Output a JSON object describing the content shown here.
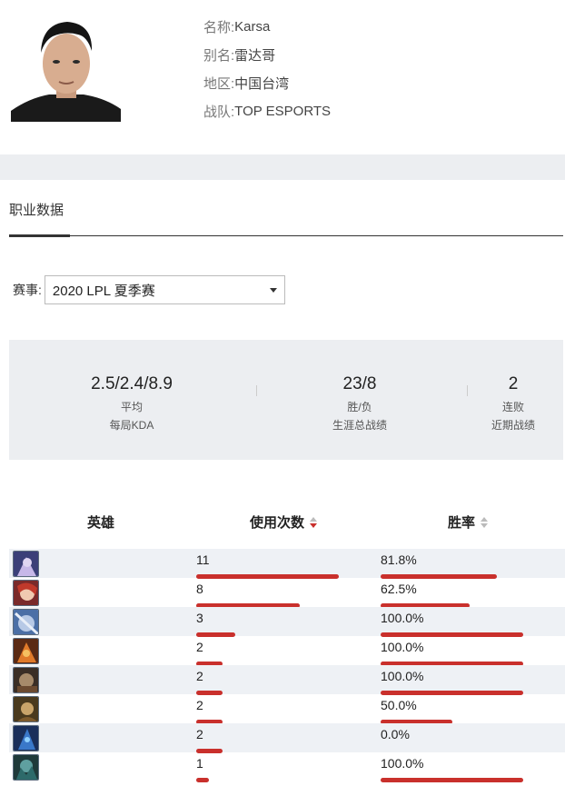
{
  "profile": {
    "name_label": "名称:",
    "name_value": "Karsa",
    "alias_label": "别名:",
    "alias_value": "雷达哥",
    "region_label": "地区:",
    "region_value": "中国台湾",
    "team_label": "战队:",
    "team_value": "TOP ESPORTS"
  },
  "tabs": {
    "active": "职业数据"
  },
  "filter": {
    "label": "赛事:",
    "selected": "2020 LPL 夏季赛"
  },
  "stats": [
    {
      "main": "2.5/2.4/8.9",
      "sub1": "平均",
      "sub2": "每局KDA"
    },
    {
      "main": "23/8",
      "sub1": "胜/负",
      "sub2": "生涯总战绩"
    },
    {
      "main": "2",
      "sub1": "连败",
      "sub2": "近期战绩"
    }
  ],
  "table": {
    "col_hero": "英雄",
    "col_count": "使用次数",
    "col_winrate": "胜率",
    "rows": [
      {
        "hero_icon": "champion-icon-1",
        "count": "11",
        "count_fraction": 1.0,
        "winrate": "81.8%",
        "winrate_fraction": 0.818
      },
      {
        "hero_icon": "champion-icon-2",
        "count": "8",
        "count_fraction": 0.727,
        "winrate": "62.5%",
        "winrate_fraction": 0.625
      },
      {
        "hero_icon": "champion-icon-3",
        "count": "3",
        "count_fraction": 0.273,
        "winrate": "100.0%",
        "winrate_fraction": 1.0
      },
      {
        "hero_icon": "champion-icon-4",
        "count": "2",
        "count_fraction": 0.182,
        "winrate": "100.0%",
        "winrate_fraction": 1.0
      },
      {
        "hero_icon": "champion-icon-5",
        "count": "2",
        "count_fraction": 0.182,
        "winrate": "100.0%",
        "winrate_fraction": 1.0
      },
      {
        "hero_icon": "champion-icon-6",
        "count": "2",
        "count_fraction": 0.182,
        "winrate": "50.0%",
        "winrate_fraction": 0.5
      },
      {
        "hero_icon": "champion-icon-7",
        "count": "2",
        "count_fraction": 0.182,
        "winrate": "0.0%",
        "winrate_fraction": 0.0
      },
      {
        "hero_icon": "champion-icon-8",
        "count": "1",
        "count_fraction": 0.091,
        "winrate": "100.0%",
        "winrate_fraction": 1.0
      }
    ]
  },
  "colors": {
    "bar": "#c9302c",
    "panel": "#eceef1",
    "row_alt": "#eef1f5"
  }
}
